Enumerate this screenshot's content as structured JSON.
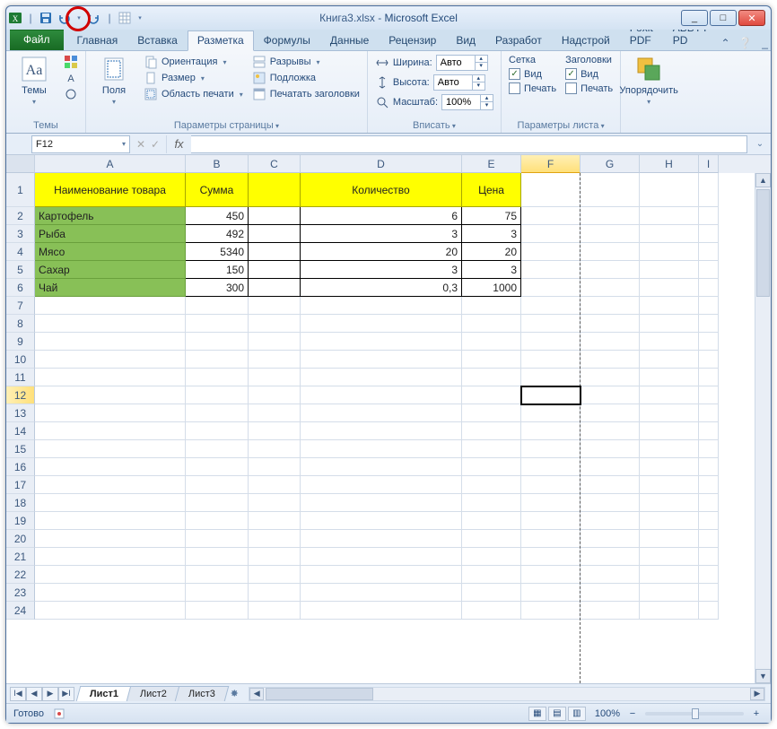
{
  "window": {
    "title_doc": "Книга3.xlsx",
    "title_app": "Microsoft Excel",
    "min": "_",
    "max": "□",
    "close": "✕"
  },
  "qat": {
    "excel_icon": "excel",
    "save": "save",
    "undo": "undo",
    "redo": "redo",
    "new": "new"
  },
  "tabs": {
    "file": "Файл",
    "items": [
      "Главная",
      "Вставка",
      "Разметка",
      "Формулы",
      "Данные",
      "Рецензир",
      "Вид",
      "Разработ",
      "Надстрой",
      "Foxit PDF",
      "ABBYY PD"
    ],
    "active_index": 2
  },
  "ribbon": {
    "themes": {
      "big": "Темы",
      "group": "Темы"
    },
    "margins": {
      "big": "Поля"
    },
    "page": {
      "orientation": "Ориентация",
      "size": "Размер",
      "print_area": "Область печати",
      "breaks": "Разрывы",
      "background": "Подложка",
      "print_titles": "Печатать заголовки",
      "group": "Параметры страницы"
    },
    "scale": {
      "width": "Ширина:",
      "width_val": "Авто",
      "height": "Высота:",
      "height_val": "Авто",
      "scale": "Масштаб:",
      "scale_val": "100%",
      "group": "Вписать"
    },
    "sheet": {
      "grid": "Сетка",
      "headings": "Заголовки",
      "view": "Вид",
      "print": "Печать",
      "group": "Параметры листа"
    },
    "arrange": {
      "big": "Упорядочить"
    }
  },
  "namebox": "F12",
  "columns": [
    "A",
    "B",
    "C",
    "D",
    "E",
    "F",
    "G",
    "H",
    "I"
  ],
  "headers": {
    "a": "Наименование товара",
    "b": "Сумма",
    "d": "Количество",
    "e": "Цена"
  },
  "rows": [
    {
      "name": "Картофель",
      "sum": "450",
      "qty": "6",
      "price": "75"
    },
    {
      "name": "Рыба",
      "sum": "492",
      "qty": "3",
      "price": "3"
    },
    {
      "name": "Мясо",
      "sum": "5340",
      "qty": "20",
      "price": "20"
    },
    {
      "name": "Сахар",
      "sum": "150",
      "qty": "3",
      "price": "3"
    },
    {
      "name": "Чай",
      "sum": "300",
      "qty": "0,3",
      "price": "1000"
    }
  ],
  "row_numbers": [
    1,
    2,
    3,
    4,
    5,
    6,
    7,
    8,
    9,
    10,
    11,
    12,
    13,
    14,
    15,
    16,
    17,
    18,
    19,
    20,
    21,
    22,
    23,
    24
  ],
  "active_cell": {
    "row": 12,
    "col": "F"
  },
  "sheets": {
    "tabs": [
      "Лист1",
      "Лист2",
      "Лист3"
    ],
    "active": 0
  },
  "status": {
    "ready": "Готово",
    "zoom": "100%"
  }
}
